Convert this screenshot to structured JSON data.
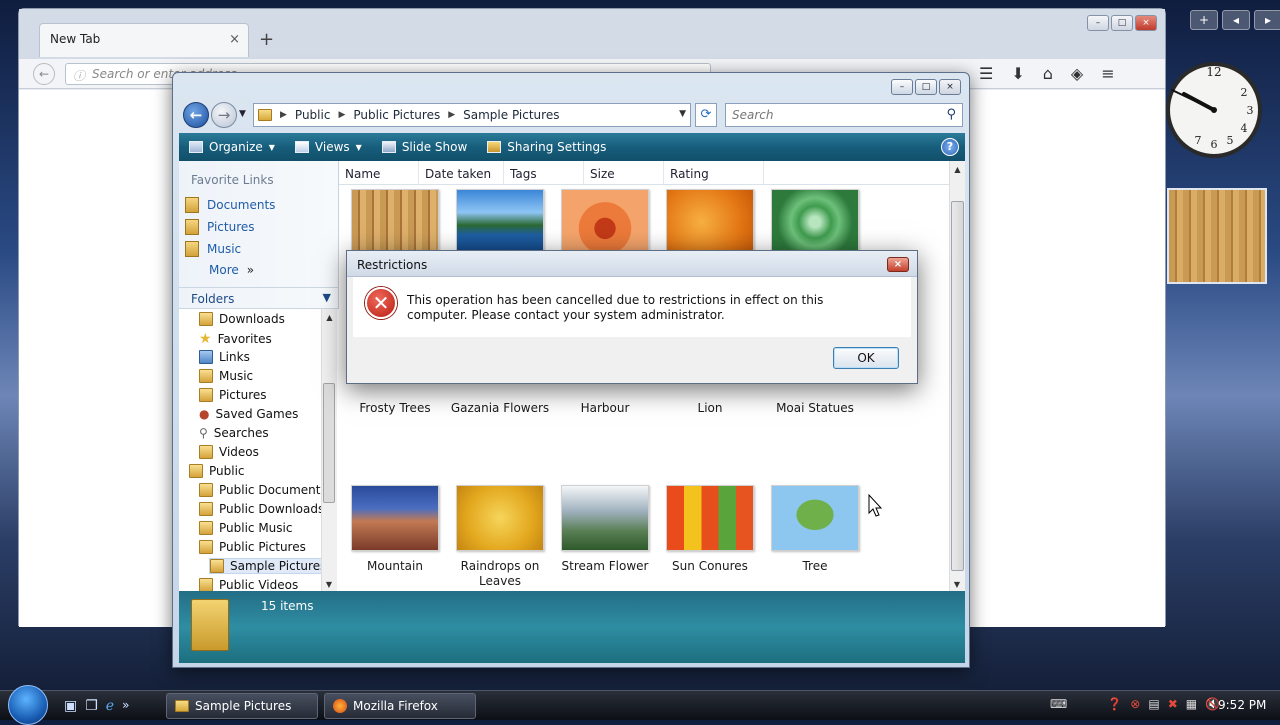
{
  "firefox": {
    "tab_title": "New Tab",
    "tab_close": "×",
    "new_tab": "+",
    "url_placeholder": "Search or enter address"
  },
  "explorer": {
    "breadcrumb": [
      "Public",
      "Public Pictures",
      "Sample Pictures"
    ],
    "search_placeholder": "Search",
    "toolbar": {
      "organize": "Organize",
      "views": "Views",
      "slideshow": "Slide Show",
      "sharing": "Sharing Settings",
      "help": "?"
    },
    "favorite_links_title": "Favorite Links",
    "favorite_links": [
      "Documents",
      "Pictures",
      "Music",
      "More"
    ],
    "folders_title": "Folders",
    "tree": [
      {
        "label": "Downloads",
        "level": 1
      },
      {
        "label": "Favorites",
        "level": 1
      },
      {
        "label": "Links",
        "level": 1
      },
      {
        "label": "Music",
        "level": 1
      },
      {
        "label": "Pictures",
        "level": 1
      },
      {
        "label": "Saved Games",
        "level": 1
      },
      {
        "label": "Searches",
        "level": 1
      },
      {
        "label": "Videos",
        "level": 1
      },
      {
        "label": "Public",
        "level": 0
      },
      {
        "label": "Public Documents",
        "level": 1
      },
      {
        "label": "Public Downloads",
        "level": 1
      },
      {
        "label": "Public Music",
        "level": 1
      },
      {
        "label": "Public Pictures",
        "level": 1
      },
      {
        "label": "Sample Pictures",
        "level": 2,
        "selected": true
      },
      {
        "label": "Public Videos",
        "level": 1
      }
    ],
    "columns": [
      "Name",
      "Date taken",
      "Tags",
      "Size",
      "Rating"
    ],
    "files_row2": [
      "Frosty Trees",
      "Gazania Flowers",
      "Harbour",
      "Lion",
      "Moai Statues"
    ],
    "files_row3": [
      "Mountain",
      "Raindrops on Leaves",
      "Stream Flower",
      "Sun Conures",
      "Tree"
    ],
    "status": "15 items"
  },
  "dialog": {
    "title": "Restrictions",
    "close": "×",
    "message": "This operation has been cancelled due to restrictions in effect on this computer. Please contact your system administrator.",
    "ok_label": "OK"
  },
  "taskbar": {
    "buttons": [
      "Sample Pictures",
      "Mozilla Firefox"
    ],
    "time": "9:52 PM"
  },
  "colors": {
    "explorer_toolbar": "#175e7c",
    "details_pane": "#2f8da3",
    "error_red": "#c3281d",
    "link_blue": "#1f5ca8"
  }
}
